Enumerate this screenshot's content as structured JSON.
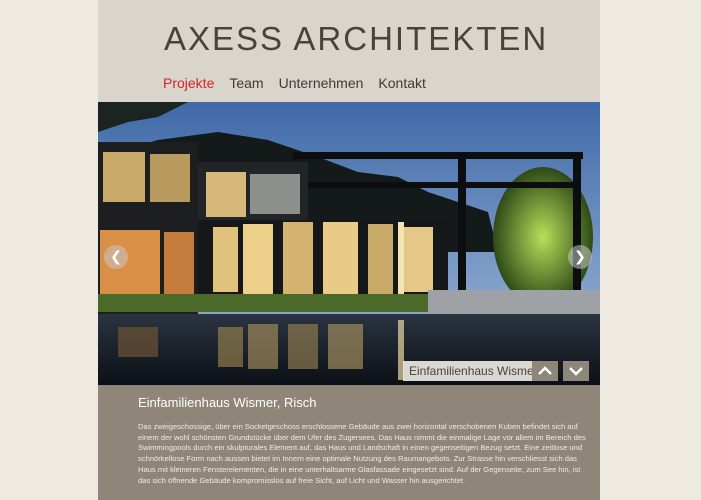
{
  "header": {
    "logo": "AXESS ARCHITEKTEN"
  },
  "nav": {
    "items": [
      "Projekte",
      "Team",
      "Unternehmen",
      "Kontakt"
    ],
    "active": "Projekte"
  },
  "slider": {
    "caption": "Einfamilienhaus Wismer",
    "prev_icon": "chevron-left-icon",
    "next_icon": "chevron-right-icon",
    "up_icon": "chevron-up-icon",
    "down_icon": "chevron-down-icon"
  },
  "project": {
    "title": "Einfamilienhaus Wismer, Risch",
    "description": "Das zweigeschossige, über ein Sockelgeschoss erschlossene Gebäude aus zwei horizontal verschobenen Kuben befindet sich auf einem der wohl schönsten Grundstücke über dem Ufer des Zugersees. Das Haus nimmt die einmalige Lage vor allem im Bereich des Swimmingpools durch ein skulpturales Element auf, das Haus und Landschaft in einen gegenseitigen Bezug setzt. Eine zeitlose und schnörkellose Form nach aussen bietet im Innern eine optimale Nutzung des Raumangebots. Zur Strasse hin verschliesst sich das Haus mit kleineren Fensterelementen, die in eine unterhaltsarme Glasfassade eingesetzt sind. Auf der Gegenseite, zum See hin, ist das sich öffnende Gebäude kompromisslos auf freie Sicht, auf Licht und Wasser hin ausgerichtet."
  },
  "colors": {
    "background": "#eee9e1",
    "header": "#d9d4cc",
    "accent": "#d2252b",
    "info_panel": "#8f8679"
  }
}
